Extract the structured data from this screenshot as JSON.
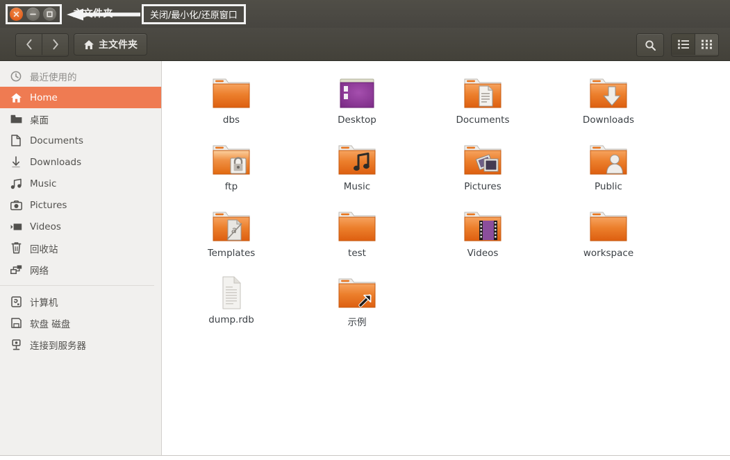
{
  "window": {
    "title": "主文件夹",
    "controls": [
      {
        "name": "close",
        "glyph": "×",
        "label": "关闭"
      },
      {
        "name": "minimize",
        "glyph": "−",
        "label": "最小化"
      },
      {
        "name": "maximize",
        "glyph": "□",
        "label": "还原窗口"
      }
    ]
  },
  "annotation": {
    "label": "关闭/最小化/还原窗口"
  },
  "toolbar": {
    "back_label": "后退",
    "forward_label": "前进",
    "path_label": "主文件夹",
    "search_label": "搜索",
    "view_list_label": "列表视图",
    "view_grid_label": "图标视图",
    "active_view": "grid"
  },
  "sidebar": {
    "groups": [
      {
        "items": [
          {
            "label": "最近使用的",
            "icon": "clock-icon",
            "state": "dim"
          },
          {
            "label": "Home",
            "icon": "home-icon",
            "state": "active"
          },
          {
            "label": "桌面",
            "icon": "folder-icon",
            "state": "normal"
          },
          {
            "label": "Documents",
            "icon": "document-icon",
            "state": "normal"
          },
          {
            "label": "Downloads",
            "icon": "download-icon",
            "state": "normal"
          },
          {
            "label": "Music",
            "icon": "music-icon",
            "state": "normal"
          },
          {
            "label": "Pictures",
            "icon": "camera-icon",
            "state": "normal"
          },
          {
            "label": "Videos",
            "icon": "video-icon",
            "state": "normal"
          },
          {
            "label": "回收站",
            "icon": "trash-icon",
            "state": "normal"
          },
          {
            "label": "网络",
            "icon": "network-icon",
            "state": "normal"
          }
        ]
      },
      {
        "items": [
          {
            "label": "计算机",
            "icon": "computer-icon",
            "state": "normal"
          },
          {
            "label": "软盘 磁盘",
            "icon": "floppy-icon",
            "state": "normal"
          },
          {
            "label": "连接到服务器",
            "icon": "connect-server-icon",
            "state": "normal"
          }
        ]
      }
    ]
  },
  "files": [
    {
      "name": "dbs",
      "icon": "folder-plain"
    },
    {
      "name": "Desktop",
      "icon": "folder-desktop"
    },
    {
      "name": "Documents",
      "icon": "folder-documents"
    },
    {
      "name": "Downloads",
      "icon": "folder-downloads"
    },
    {
      "name": "ftp",
      "icon": "folder-locked"
    },
    {
      "name": "Music",
      "icon": "folder-music"
    },
    {
      "name": "Pictures",
      "icon": "folder-pictures"
    },
    {
      "name": "Public",
      "icon": "folder-public"
    },
    {
      "name": "Templates",
      "icon": "folder-templates"
    },
    {
      "name": "test",
      "icon": "folder-plain"
    },
    {
      "name": "Videos",
      "icon": "folder-videos"
    },
    {
      "name": "workspace",
      "icon": "folder-plain"
    },
    {
      "name": "dump.rdb",
      "icon": "file-document"
    },
    {
      "name": "示例",
      "icon": "folder-shortcut"
    }
  ],
  "colors": {
    "titlebar": "#4a4842",
    "sidebar_bg": "#f1f0ee",
    "selection": "#ef7b52",
    "folder_orange": "#e8761f",
    "desktop_purple": "#8e3b94",
    "file_label": "#3b4045"
  }
}
